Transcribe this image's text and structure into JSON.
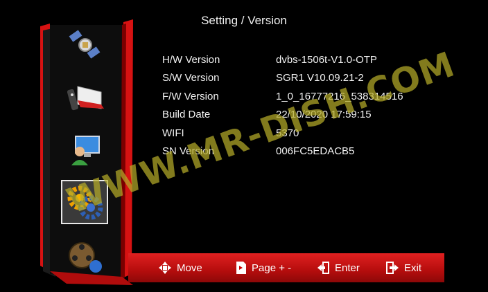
{
  "title": "Setting / Version",
  "info": [
    {
      "label": "H/W Version",
      "value": "dvbs-1506t-V1.0-OTP"
    },
    {
      "label": "S/W Version",
      "value": "SGR1 V10.09.21-2"
    },
    {
      "label": "F/W Version",
      "value": "1_0_16777216_538314516"
    },
    {
      "label": "Build Date",
      "value": "22/10/2020 17:59:15"
    },
    {
      "label": "WIFI",
      "value": "5370"
    },
    {
      "label": "SN Version",
      "value": "006FC5EDACB5"
    }
  ],
  "watermark": "WWW.MR-DISH.COM",
  "sidebar": {
    "items": [
      {
        "icon": "satellite-icon"
      },
      {
        "icon": "tv-remote-icon"
      },
      {
        "icon": "user-computer-icon"
      },
      {
        "icon": "gear-icon",
        "selected": true
      },
      {
        "icon": "film-reel-icon"
      }
    ]
  },
  "footer": {
    "move": "Move",
    "page": "Page + -",
    "enter": "Enter",
    "exit": "Exit"
  },
  "colors": {
    "accent": "#d81414",
    "background": "#000000"
  }
}
